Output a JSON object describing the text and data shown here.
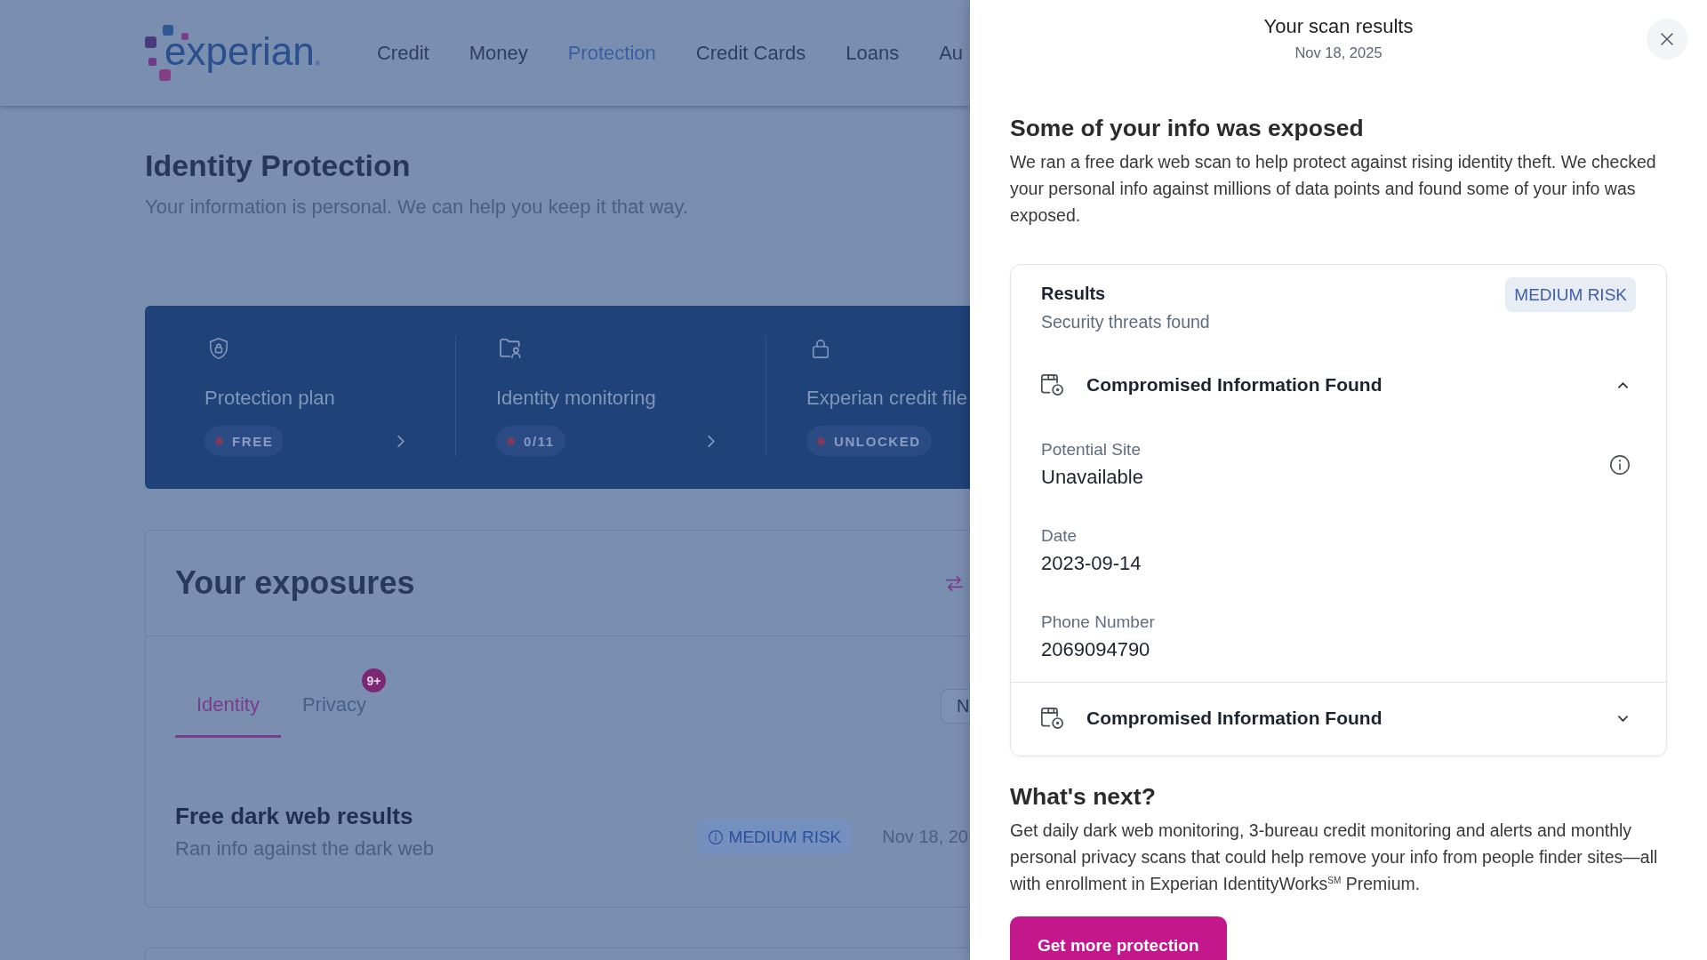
{
  "header": {
    "logo": {
      "wordmark": "experian",
      "mark": "®"
    },
    "nav": [
      {
        "label": "Credit",
        "selected": false
      },
      {
        "label": "Money",
        "selected": false
      },
      {
        "label": "Protection",
        "selected": true
      },
      {
        "label": "Credit Cards",
        "selected": false
      },
      {
        "label": "Loans",
        "selected": false
      },
      {
        "label": "Au",
        "selected": false
      }
    ]
  },
  "page": {
    "title": "Identity Protection",
    "subtitle": "Your information is personal. We can help you keep it that way."
  },
  "summary_cards": [
    {
      "label": "Protection plan",
      "status": "FREE",
      "arrow": true
    },
    {
      "label": "Identity monitoring",
      "status": "0/11",
      "arrow": true
    },
    {
      "label": "Experian credit file",
      "status": "UNLOCKED"
    }
  ],
  "exposures": {
    "title": "Your exposures",
    "tabs": [
      {
        "label": "Identity",
        "selected": true
      },
      {
        "label": "Privacy",
        "selected": false,
        "badge": "9+"
      }
    ],
    "filter_button": "N",
    "results": [
      {
        "title": "Free dark web results",
        "subtitle": "Ran info against the dark web",
        "risk": "MEDIUM RISK",
        "date": "Nov 18, 20"
      }
    ]
  },
  "drawer": {
    "title": "Your scan results",
    "date": "Nov 18, 2025",
    "heading": "Some of your info was exposed",
    "body": "We ran a free dark web scan to help protect against rising identity theft. We checked your personal info against millions of data points and found some of your info was exposed.",
    "results": {
      "title": "Results",
      "subtitle": "Security threats found",
      "risk": "MEDIUM RISK",
      "sections": [
        {
          "title": "Compromised Information Found",
          "expanded": true,
          "fields": [
            {
              "label": "Potential Site",
              "value": "Unavailable",
              "info": true
            },
            {
              "label": "Date",
              "value": "2023-09-14",
              "info": false
            },
            {
              "label": "Phone Number",
              "value": "2069094790",
              "info": false
            }
          ]
        },
        {
          "title": "Compromised Information Found",
          "expanded": false
        }
      ]
    },
    "next": {
      "heading": "What's next?",
      "body": "Get daily dark web monitoring, 3-bureau credit monitoring and alerts and monthly personal privacy scans that could help remove your info from people finder sites—all with enrollment in Experian IdentityWorks$^{SM}$ Premium.",
      "button": "Get more protection"
    }
  }
}
